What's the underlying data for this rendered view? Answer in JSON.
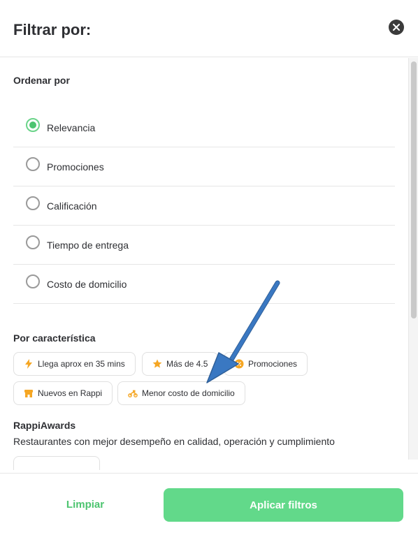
{
  "header": {
    "title": "Filtrar por:",
    "close_icon": "close-icon"
  },
  "sort": {
    "title": "Ordenar por",
    "selected_index": 0,
    "options": [
      {
        "label": "Relevancia",
        "checked": true
      },
      {
        "label": "Promociones",
        "checked": false
      },
      {
        "label": "Calificación",
        "checked": false
      },
      {
        "label": "Tiempo de entrega",
        "checked": false
      },
      {
        "label": "Costo de domicilio",
        "checked": false
      }
    ]
  },
  "features": {
    "title": "Por característica",
    "chips": [
      {
        "label": "Llega aprox en 35 mins",
        "icon": "lightning-icon"
      },
      {
        "label": "Más de 4.5",
        "icon": "star-icon"
      },
      {
        "label": "Promociones",
        "icon": "badge-percent-icon"
      },
      {
        "label": "Nuevos en Rappi",
        "icon": "store-icon"
      },
      {
        "label": "Menor costo de domicilio",
        "icon": "scooter-icon"
      }
    ]
  },
  "awards": {
    "title": "RappiAwards",
    "description": "Restaurantes con mejor desempeño en calidad, operación y cumplimiento"
  },
  "footer": {
    "clear_label": "Limpiar",
    "apply_label": "Aplicar filtros"
  },
  "colors": {
    "accent_green": "#62d98a",
    "text_green": "#4cc46f",
    "icon_orange": "#f5a623",
    "annotation_arrow": "#3a78c2"
  }
}
